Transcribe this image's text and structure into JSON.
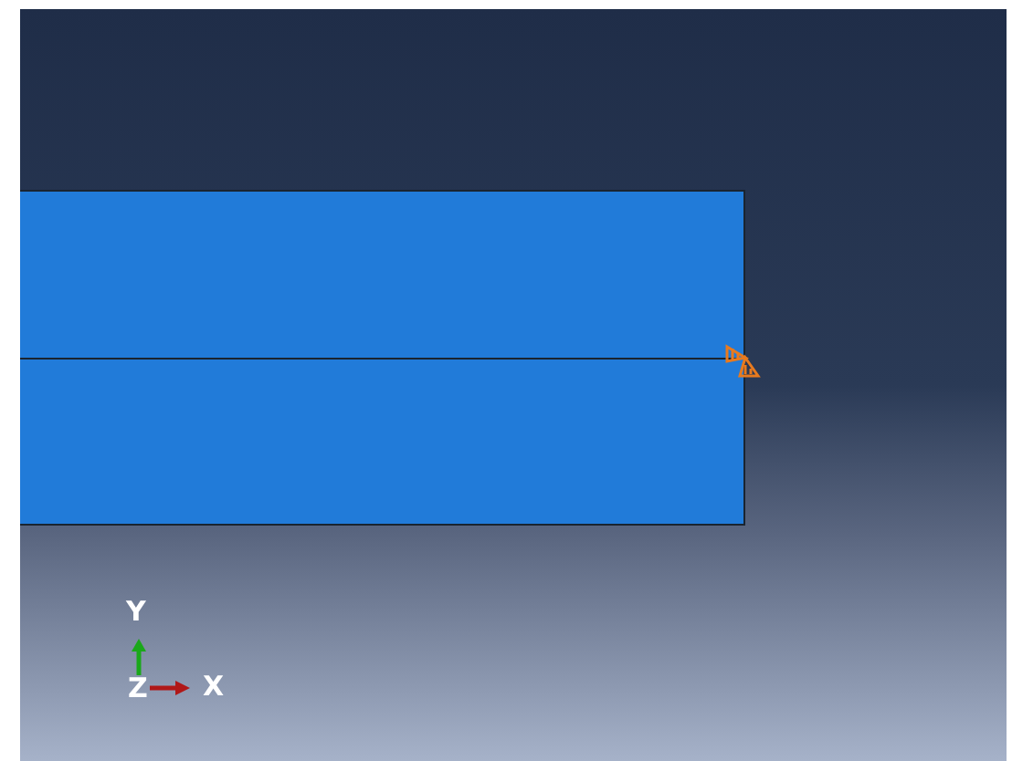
{
  "viewport": {
    "triad": {
      "y_label": "Y",
      "z_label": "Z",
      "x_label": "X"
    }
  }
}
